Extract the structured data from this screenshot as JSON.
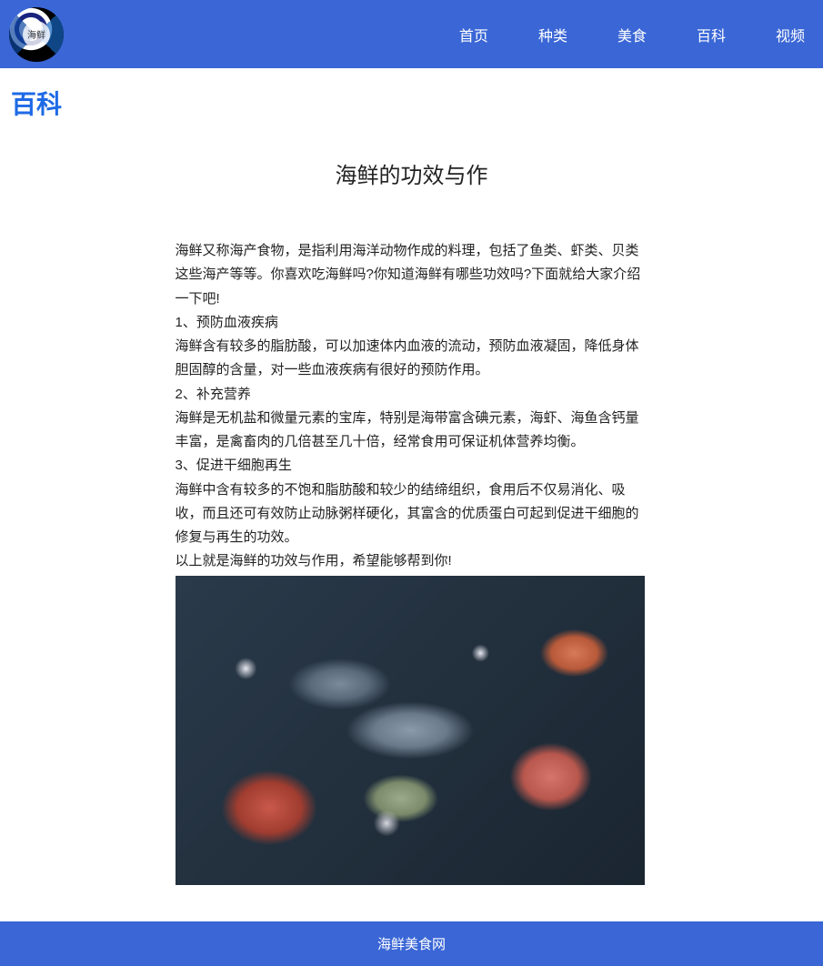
{
  "nav": {
    "items": [
      {
        "label": "首页"
      },
      {
        "label": "种类"
      },
      {
        "label": "美食"
      },
      {
        "label": "百科"
      },
      {
        "label": "视频"
      }
    ]
  },
  "page": {
    "title": "百科"
  },
  "article": {
    "title": "海鲜的功效与作",
    "paragraphs": [
      "海鲜又称海产食物，是指利用海洋动物作成的料理，包括了鱼类、虾类、贝类这些海产等等。你喜欢吃海鲜吗?你知道海鲜有哪些功效吗?下面就给大家介绍一下吧!",
      "1、预防血液疾病",
      "海鲜含有较多的脂肪酸，可以加速体内血液的流动，预防血液凝固，降低身体胆固醇的含量，对一些血液疾病有很好的预防作用。",
      "2、补充营养",
      "海鲜是无机盐和微量元素的宝库，特别是海带富含碘元素，海虾、海鱼含钙量丰富，是禽畜肉的几倍甚至几十倍，经常食用可保证机体营养均衡。",
      "3、促进干细胞再生",
      "海鲜中含有较多的不饱和脂肪酸和较少的结缔组织，食用后不仅易消化、吸收，而且还可有效防止动脉粥样硬化，其富含的优质蛋白可起到促进干细胞的修复与再生的功效。",
      "以上就是海鲜的功效与作用，希望能够帮到你!"
    ]
  },
  "footer": {
    "text": "海鲜美食网"
  }
}
